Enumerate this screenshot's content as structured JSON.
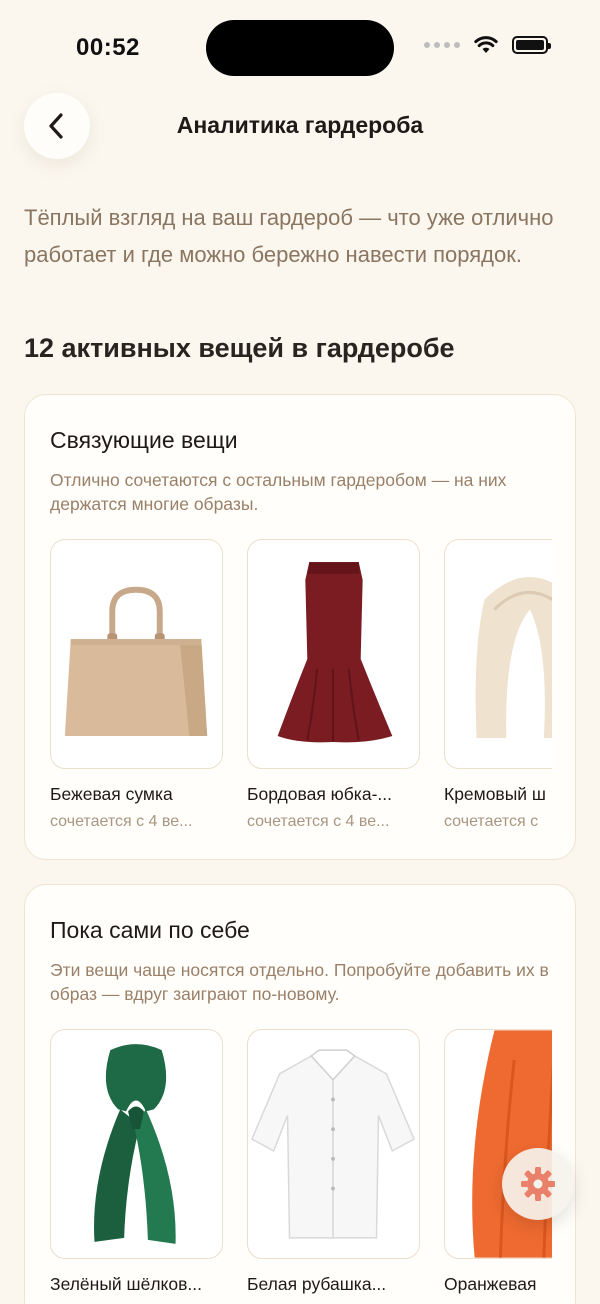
{
  "status_bar": {
    "time": "00:52"
  },
  "header": {
    "title": "Аналитика гардероба",
    "back_icon": "chevron-left-icon"
  },
  "intro": "Тёплый взгляд на ваш гардероб — что уже отлично работает и где можно бережно навести порядок.",
  "summary": {
    "heading": "12 активных вещей в гардеробе"
  },
  "sections": [
    {
      "title": "Связующие вещи",
      "description": "Отлично сочетаются с остальным гардеробом — на них держатся многие образы.",
      "items": [
        {
          "name": "Бежевая сумка",
          "subtitle": "сочетается с 4 ве...",
          "icon": "beige-handbag"
        },
        {
          "name": "Бордовая юбка-...",
          "subtitle": "сочетается с 4 ве...",
          "icon": "burgundy-mermaid-skirt"
        },
        {
          "name": "Кремовый ш",
          "subtitle": "сочетается с",
          "icon": "cream-scarf"
        }
      ]
    },
    {
      "title": "Пока сами по себе",
      "description": "Эти вещи чаще носятся отдельно. Попробуйте добавить их в образ — вдруг заиграют по-новому.",
      "items": [
        {
          "name": "Зелёный шёлков...",
          "icon": "green-silk-scarf"
        },
        {
          "name": "Белая рубашка...",
          "icon": "white-shirt"
        },
        {
          "name": "Оранжевая",
          "icon": "orange-skirt"
        }
      ]
    }
  ],
  "fab": {
    "icon": "gear-icon"
  },
  "colors": {
    "background": "#fbf7ef",
    "accent": "#e8806a",
    "muted_text": "#8a7560"
  }
}
